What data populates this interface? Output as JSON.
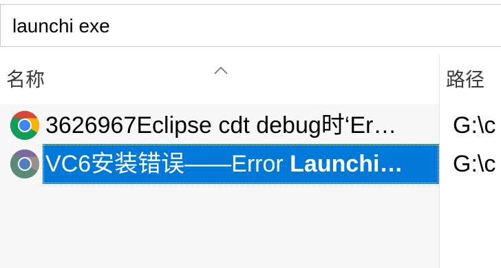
{
  "search": {
    "value": "launchi exe"
  },
  "columns": {
    "name_label": "名称",
    "path_label": "路径"
  },
  "rows": [
    {
      "icon": "chrome-icon",
      "name": "3626967Eclipse cdt debug时‘Er…",
      "path": "G:\\c",
      "selected": false
    },
    {
      "icon": "chrome-icon",
      "name_prefix": "VC6安装错误——Error ",
      "name_bold": "Launchi…",
      "path": "G:\\c",
      "selected": true
    }
  ],
  "colors": {
    "selection": "#0078d7",
    "row_background": "#f7f7f7"
  }
}
